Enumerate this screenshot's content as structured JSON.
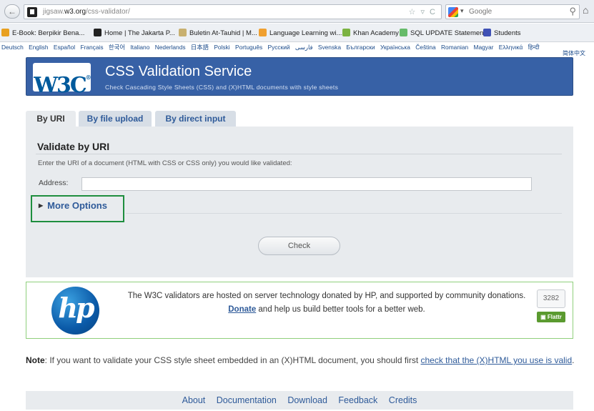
{
  "browser": {
    "url_prefix": "jigsaw.",
    "url_domain": "w3.org",
    "url_path": "/css-validator/",
    "search_placeholder": "Google",
    "back_glyph": "←",
    "home_glyph": "⌂",
    "search_glyph": "⚲",
    "url_icons": "☆ ▿ C"
  },
  "bookmarks": [
    {
      "label": "E-Book: Berpikir Bena...",
      "icon_color": "#e8a020",
      "icon": "book-icon"
    },
    {
      "label": "Home | The Jakarta P...",
      "icon_color": "#222222",
      "icon": "jakarta-post-icon"
    },
    {
      "label": "Buletin At-Tauhid | M...",
      "icon_color": "#c8b070",
      "icon": "page-icon"
    },
    {
      "label": "Language Learning wi...",
      "icon_color": "#f0a030",
      "icon": "language-icon"
    },
    {
      "label": "Khan Academy",
      "icon_color": "#7cb342",
      "icon": "leaf-icon"
    },
    {
      "label": "SQL UPDATE Statement",
      "icon_color": "#66bb6a",
      "icon": "w3schools-icon"
    },
    {
      "label": "Students",
      "icon_color": "#3f51b5",
      "icon": "students-icon"
    }
  ],
  "languages": [
    "Deutsch",
    "English",
    "Español",
    "Français",
    "한국어",
    "Italiano",
    "Nederlands",
    "日本語",
    "Polski",
    "Português",
    "Русский",
    "فارسی",
    "Svenska",
    "Български",
    "Українська",
    "Čeština",
    "Romanian",
    "Magyar",
    "Ελληνικά",
    "हिन्दी"
  ],
  "languages_extra": "简体中文",
  "banner": {
    "logo": "W3C",
    "logo_reg": "®",
    "title": "CSS Validation Service",
    "subtitle": "Check Cascading Style Sheets (CSS) and (X)HTML documents with style sheets",
    "color": "#3761a6"
  },
  "tabs": [
    {
      "label": "By URI",
      "active": true
    },
    {
      "label": "By file upload",
      "active": false
    },
    {
      "label": "By direct input",
      "active": false
    }
  ],
  "form": {
    "title": "Validate by URI",
    "description": "Enter the URI of a document (HTML with CSS or CSS only) you would like validated:",
    "address_label": "Address:",
    "address_value": "",
    "more_options": "More Options",
    "more_triangle": "▶",
    "check_button": "Check"
  },
  "hp": {
    "logo_text": "hp",
    "line1": "The W3C validators are hosted on server technology donated by HP, and supported by community donations.",
    "donate_link": "Donate",
    "line2_rest": " and help us build better tools for a better web.",
    "flattr_count": "3282",
    "flattr_label": "Flattr"
  },
  "note": {
    "label": "Note",
    "text": ": If you want to validate your CSS style sheet embedded in an (X)HTML document, you should first ",
    "link": "check that the (X)HTML you use is valid",
    "end": "."
  },
  "footer": [
    "About",
    "Documentation",
    "Download",
    "Feedback",
    "Credits"
  ]
}
